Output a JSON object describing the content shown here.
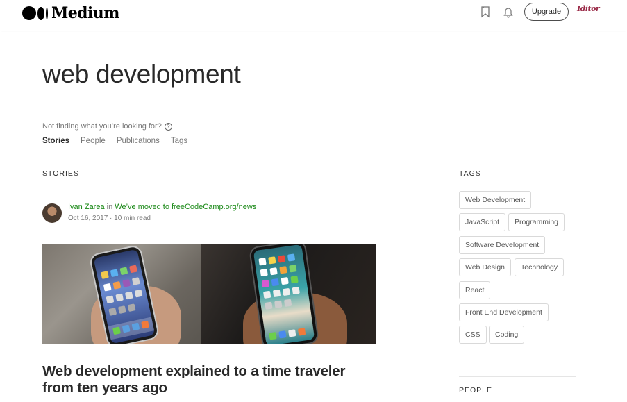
{
  "header": {
    "logo_text": "Medium",
    "upgrade_label": "Upgrade",
    "user_avatar_text": "Iditor"
  },
  "search": {
    "query": "web development",
    "not_finding": "Not finding what you’re looking for?",
    "help_glyph": "?",
    "filters": [
      "Stories",
      "People",
      "Publications",
      "Tags"
    ],
    "active_filter": "Stories"
  },
  "stories": {
    "section_label": "STORIES",
    "items": [
      {
        "author": "Ivan Zarea",
        "in_word": " in ",
        "publication": "We’ve moved to freeCodeCamp.org/news",
        "date": "Oct 16, 2017",
        "separator": " · ",
        "read_time": "10 min read",
        "title": "Web development explained to a time traveler from ten years ago"
      }
    ]
  },
  "sidebar": {
    "tags_label": "TAGS",
    "tags": [
      "Web Development",
      "JavaScript",
      "Programming",
      "Software Development",
      "Web Design",
      "Technology",
      "React",
      "Front End Development",
      "CSS",
      "Coding"
    ],
    "people_label": "PEOPLE"
  },
  "colors": {
    "accent_green": "#1a8917",
    "text_primary": "rgba(0,0,0,0.84)",
    "text_secondary": "rgba(0,0,0,0.54)"
  },
  "icons": [
    "bookmark-icon",
    "bell-icon",
    "help-circle-icon"
  ]
}
